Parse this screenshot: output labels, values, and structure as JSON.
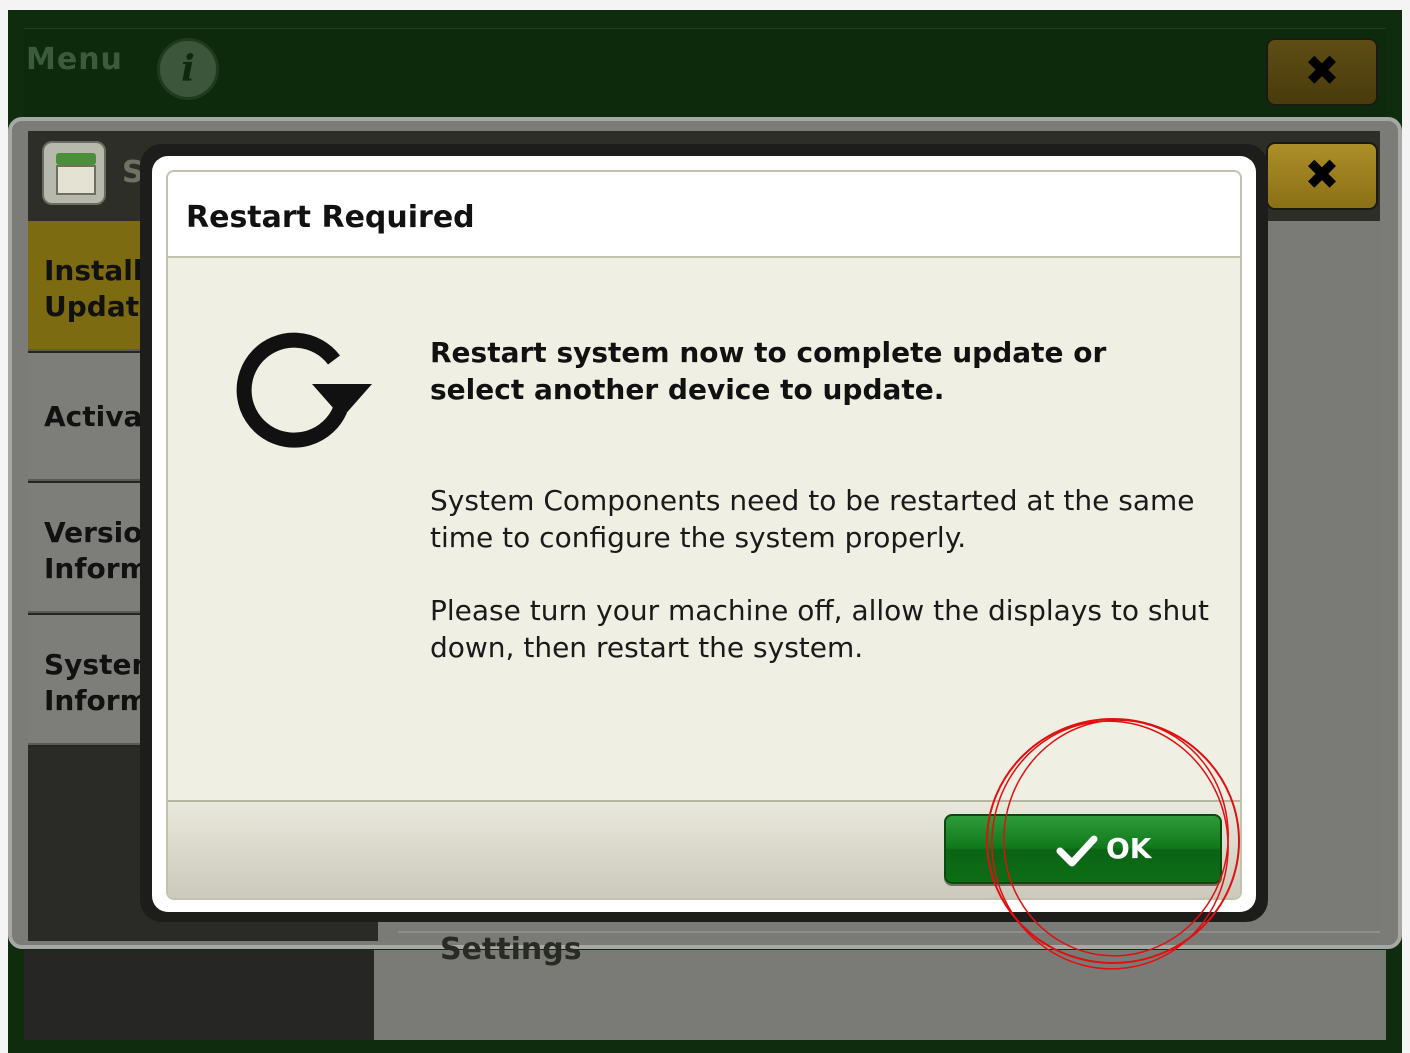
{
  "menu": {
    "title": "Menu",
    "info_icon_glyph": "i",
    "close_glyph": "✖"
  },
  "app_window": {
    "title_visible": "So",
    "close_glyph": "✖",
    "nav_items": [
      {
        "label": "Installa\nUpdate",
        "active": true
      },
      {
        "label": "Activati",
        "active": false
      },
      {
        "label": "Version\nInform",
        "active": false
      },
      {
        "label": "System\nInform",
        "active": false
      }
    ],
    "partial_label": "Settings"
  },
  "dialog": {
    "title": "Restart Required",
    "icon": "restart-icon",
    "message_bold": "Restart system now to complete update or select another device to update.",
    "paragraph_1": "System Components need to be restarted at the same time to configure the system properly.",
    "paragraph_2": "Please turn your machine off, allow the displays to shut down, then restart the system.",
    "ok_label": "OK",
    "ok_icon": "checkmark-icon"
  },
  "colors": {
    "accent_green": "#11781c",
    "annotation_red": "#e01010",
    "active_nav": "#7d6b12"
  }
}
